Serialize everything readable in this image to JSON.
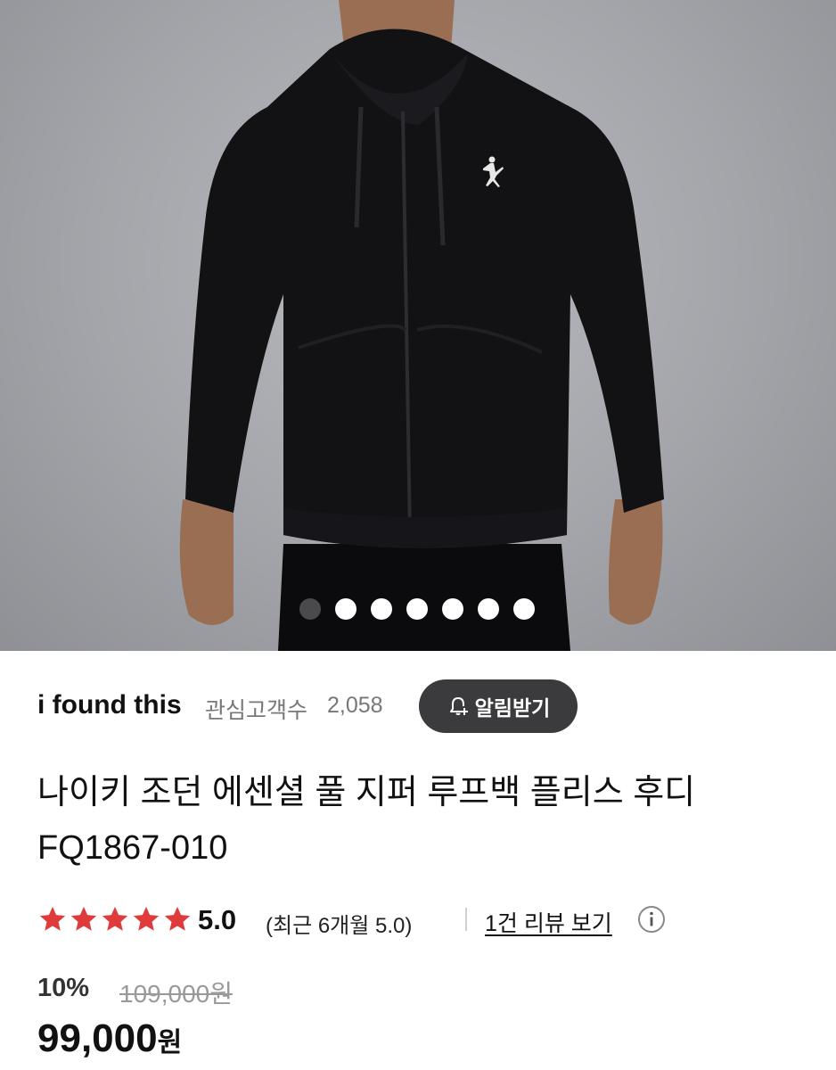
{
  "gallery": {
    "image_alt": "black full-zip hoodie product photo",
    "dot_count": 7,
    "active_index": 0
  },
  "store": {
    "name": "i found this",
    "fans_label": "관심고객수",
    "fans_count": "2,058",
    "alert_button_label": "알림받기"
  },
  "product": {
    "title": "나이키 조던 에센셜 풀 지퍼 루프백 플리스 후디 FQ1867-010"
  },
  "rating": {
    "stars": 5,
    "score": "5.0",
    "recent_text": "(최근 6개월 5.0)",
    "review_link": "1건 리뷰 보기"
  },
  "price": {
    "discount": "10%",
    "original": "109,000원",
    "sale": "99,000",
    "unit": "원"
  },
  "colors": {
    "star": "#e03b3b",
    "button_bg": "#3b3b3d"
  }
}
